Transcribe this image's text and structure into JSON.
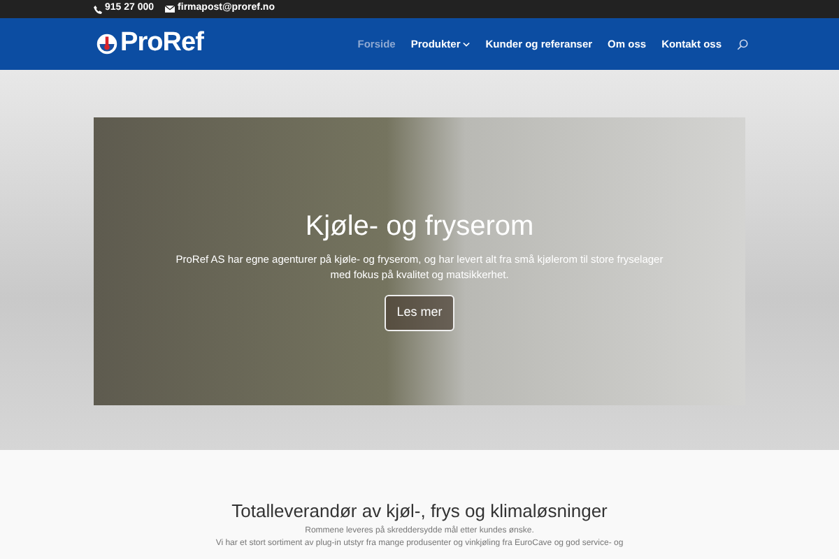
{
  "top_bar": {
    "phone": "915 27 000",
    "email": "firmapost@proref.no"
  },
  "header": {
    "logo": "ProRef",
    "nav": [
      {
        "label": "Forside",
        "selected": true,
        "dropdown": false
      },
      {
        "label": "Produkter",
        "selected": false,
        "dropdown": true
      },
      {
        "label": "Kunder og referanser",
        "selected": false,
        "dropdown": false
      },
      {
        "label": "Om oss",
        "selected": false,
        "dropdown": false
      },
      {
        "label": "Kontakt oss",
        "selected": false,
        "dropdown": false
      }
    ]
  },
  "hero": {
    "title": "Kjøle- og fryserom",
    "text": "ProRef AS har egne agenturer på kjøle- og fryserom, og har levert alt fra små kjølerom til store fryselager med fokus på kvalitet og matsikkerhet.",
    "button": "Les mer"
  },
  "intro": {
    "heading": "Totalleverandør av kjøl-, frys og klimaløsninger",
    "lines": [
      "Rommene leveres på skreddersydde mål etter kundes ønske.",
      "Vi har et stort sortiment av plug-in utstyr fra mange produsenter og vinkjøling fra EuroCave og god service- og"
    ]
  }
}
